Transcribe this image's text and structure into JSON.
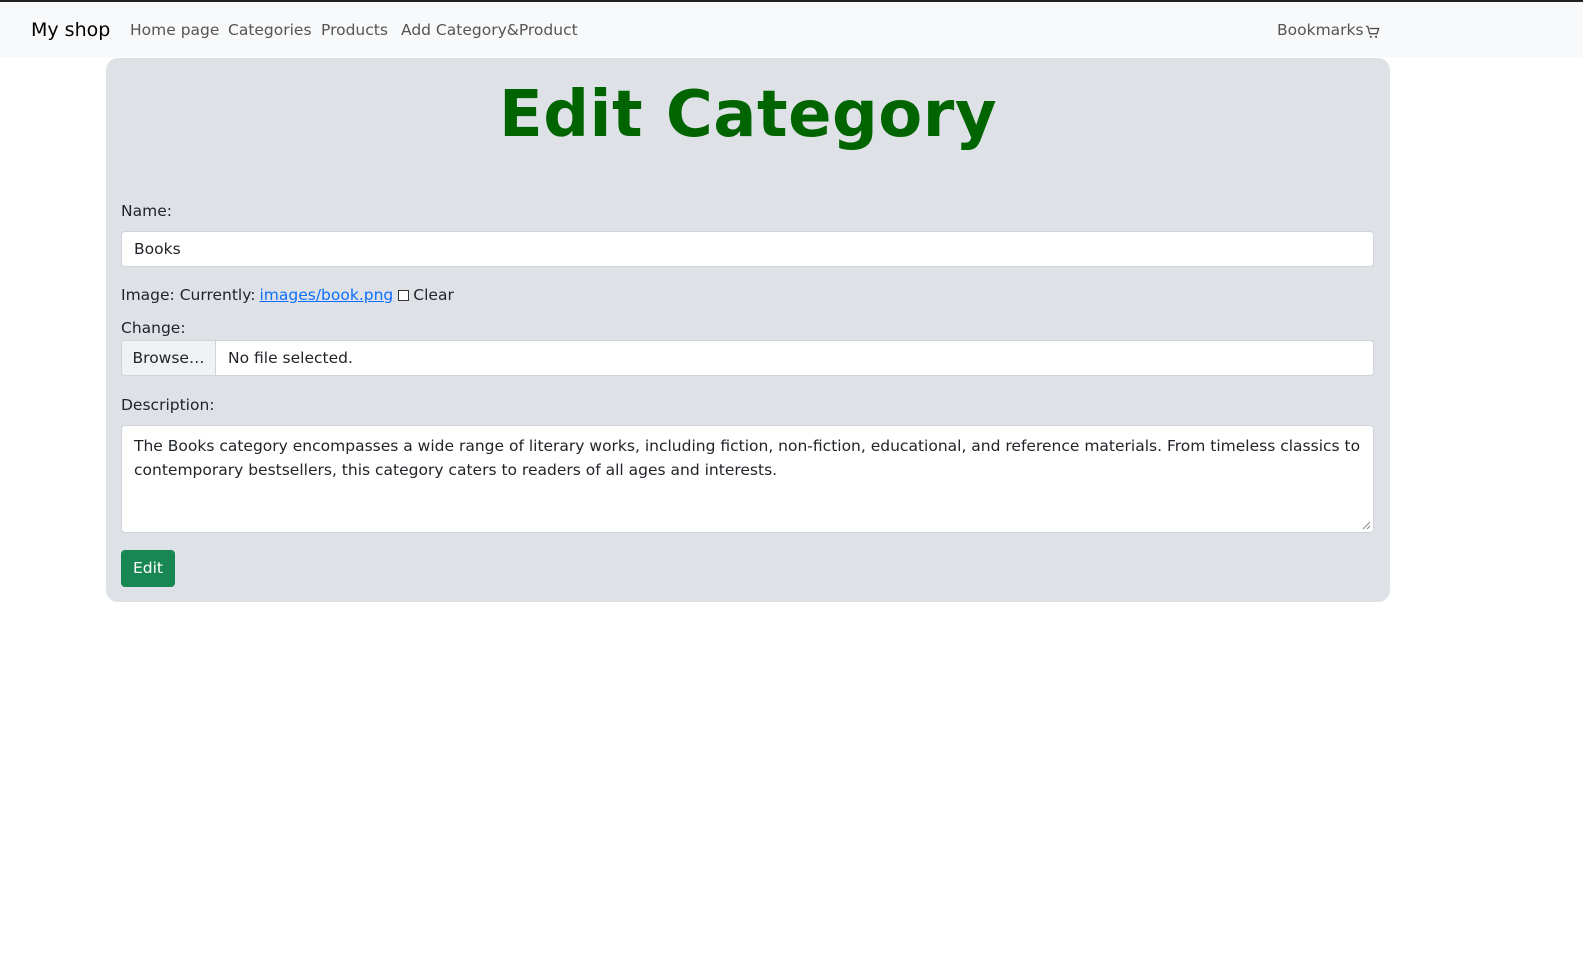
{
  "navbar": {
    "brand": "My shop",
    "links": [
      "Home page",
      "Categories",
      "Products",
      "Add Category&Product"
    ],
    "bookmarks": "Bookmarks",
    "cart_icon": "cart-icon"
  },
  "form": {
    "title": "Edit Category",
    "name_label": "Name:",
    "name_value": "Books",
    "image_label": "Image: Currently:",
    "image_link": "images/book.png",
    "clear_label": "Clear",
    "change_label": "Change:",
    "browse_label": "Browse…",
    "file_status": "No file selected.",
    "description_label": "Description:",
    "description_value": "The Books category encompasses a wide range of literary works, including fiction, non-fiction, educational, and reference materials. From timeless classics to contemporary bestsellers, this category caters to readers of all ages and interests.",
    "submit_label": "Edit"
  },
  "colors": {
    "title": "#006400",
    "card_bg": "#dee2e6",
    "submit_bg": "#198754",
    "link": "#0d6efd"
  }
}
